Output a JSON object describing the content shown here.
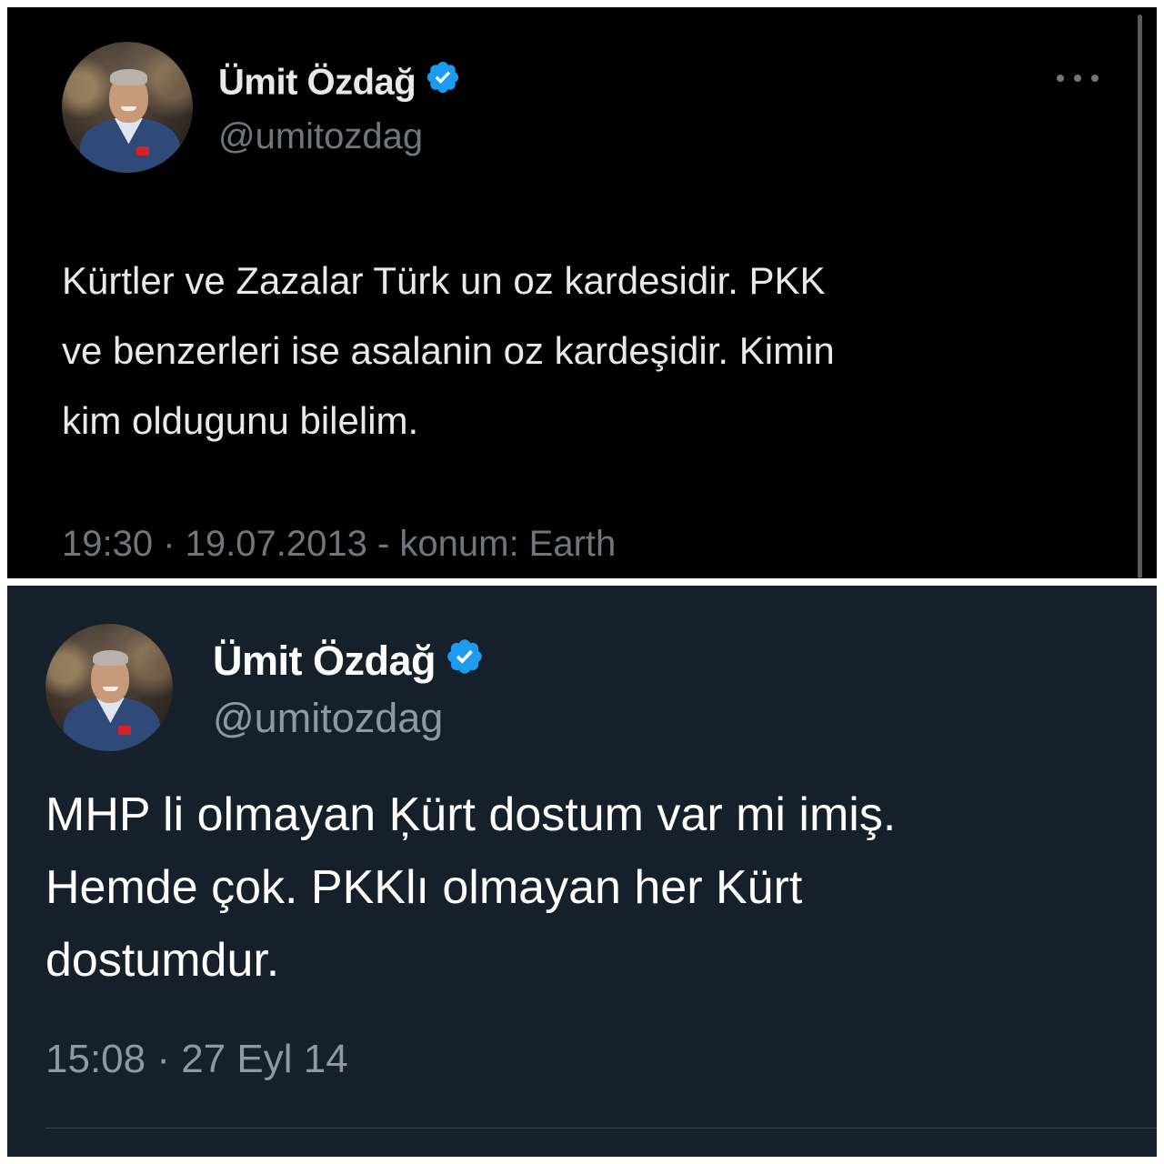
{
  "colors": {
    "dark_background": "#000000",
    "dim_background": "#15202b",
    "verified_badge": "#1d9bf0",
    "secondary_text_dark": "#71767b",
    "secondary_text_dim": "#8b98a5"
  },
  "tweets": [
    {
      "theme": "dark",
      "author": {
        "name": "Ümit Özdağ",
        "handle": "@umitozdag",
        "verified_icon": "verified-badge-icon",
        "avatar_icon": "profile-photo"
      },
      "more_icon": "more-options-icon",
      "text": "Kürtler ve Zazalar Türk un oz kardesidir. PKK\nve benzerleri ise asalanin oz kardeşidir. Kimin\nkim oldugunu bilelim.",
      "meta": "19:30 · 19.07.2013 - konum: Earth"
    },
    {
      "theme": "dim",
      "author": {
        "name": "Ümit Özdağ",
        "handle": "@umitozdag",
        "verified_icon": "verified-badge-icon",
        "avatar_icon": "profile-photo"
      },
      "text": "MHP li olmayan Ķürt dostum var mi imiş.\nHemde çok. PKKlı olmayan her Kürt\ndostumdur.",
      "meta": "15:08 · 27 Eyl 14"
    }
  ]
}
